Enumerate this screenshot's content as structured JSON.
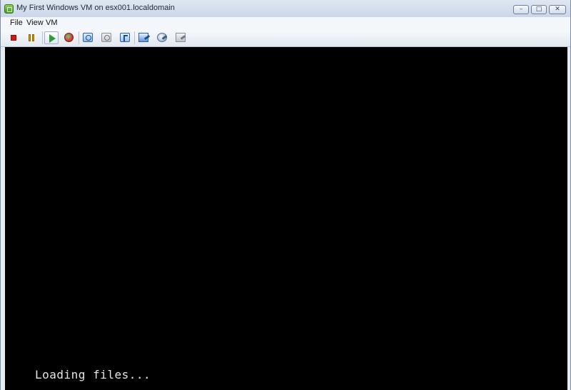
{
  "window": {
    "title": "My First Windows VM on esx001.localdomain",
    "app_icon": "vsphere-console-icon",
    "controls": {
      "minimize_glyph": "–",
      "maximize_glyph": "□",
      "close_glyph": "✕"
    }
  },
  "menubar": {
    "items": [
      {
        "label": "File"
      },
      {
        "label": "View"
      },
      {
        "label": "VM"
      }
    ]
  },
  "toolbar": {
    "buttons": [
      {
        "icon": "power-off-icon",
        "color": "#d31818"
      },
      {
        "icon": "suspend-icon",
        "color": "#e0a000"
      },
      {
        "icon": "power-on-icon",
        "color": "#2f9e2f",
        "active": true
      },
      {
        "icon": "reset-icon",
        "color": "#d02a2a"
      },
      {
        "icon": "take-snapshot-icon"
      },
      {
        "icon": "revert-snapshot-icon"
      },
      {
        "icon": "snapshot-manager-icon"
      },
      {
        "icon": "edit-settings-icon"
      },
      {
        "icon": "connect-devices-icon"
      },
      {
        "icon": "vmware-tools-icon"
      }
    ]
  },
  "console": {
    "background": "#000000",
    "text": "Loading files..."
  }
}
